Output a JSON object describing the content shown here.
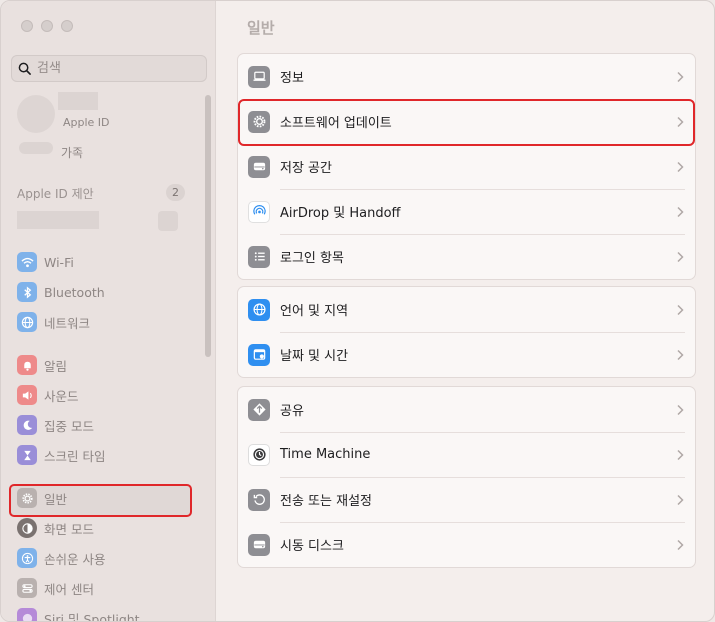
{
  "sidebar": {
    "search": {
      "placeholder": "검색"
    },
    "account": {
      "subtitle": "Apple ID",
      "family_label": "가족"
    },
    "suggestions": {
      "label": "Apple ID 제안",
      "count": "2"
    },
    "items": [
      {
        "label": "Wi-Fi",
        "icon": "wifi-icon",
        "color": "#7fb2ea"
      },
      {
        "label": "Bluetooth",
        "icon": "bluetooth-icon",
        "color": "#7fb2ea"
      },
      {
        "label": "네트워크",
        "icon": "globe-icon",
        "color": "#7fb2ea"
      },
      {
        "label": "알림",
        "icon": "bell-icon",
        "color": "#ee8a8a"
      },
      {
        "label": "사운드",
        "icon": "speaker-icon",
        "color": "#ee8a8a"
      },
      {
        "label": "집중 모드",
        "icon": "moon-icon",
        "color": "#9a8ed8"
      },
      {
        "label": "스크린 타임",
        "icon": "hourglass-icon",
        "color": "#9a8ed8"
      },
      {
        "label": "일반",
        "icon": "gear-icon",
        "color": "#b9b1af"
      },
      {
        "label": "화면 모드",
        "icon": "appearance-icon",
        "color": "#7a7270"
      },
      {
        "label": "손쉬운 사용",
        "icon": "accessibility-icon",
        "color": "#7fb2ea"
      },
      {
        "label": "제어 센터",
        "icon": "control-center-icon",
        "color": "#b9b1af"
      },
      {
        "label": "Siri 및 Spotlight",
        "icon": "siri-icon",
        "color": "#b58ad8"
      }
    ]
  },
  "main": {
    "title": "일반",
    "groups": [
      [
        {
          "label": "정보",
          "icon": "laptop-icon",
          "color": "#8e8e93"
        },
        {
          "label": "소프트웨어 업데이트",
          "icon": "gear-icon",
          "color": "#8e8e93"
        },
        {
          "label": "저장 공간",
          "icon": "drive-icon",
          "color": "#8e8e93"
        },
        {
          "label": "AirDrop 및 Handoff",
          "icon": "airdrop-icon",
          "color": "#2f8ff0"
        },
        {
          "label": "로그인 항목",
          "icon": "list-icon",
          "color": "#8e8e93"
        }
      ],
      [
        {
          "label": "언어 및 지역",
          "icon": "globe-icon",
          "color": "#2f8ff0"
        },
        {
          "label": "날짜 및 시간",
          "icon": "calendar-icon",
          "color": "#2f8ff0"
        }
      ],
      [
        {
          "label": "공유",
          "icon": "share-icon",
          "color": "#8e8e93"
        },
        {
          "label": "Time Machine",
          "icon": "time-machine-icon",
          "color": "#3a3a3c"
        },
        {
          "label": "전송 또는 재설정",
          "icon": "reset-icon",
          "color": "#8e8e93"
        },
        {
          "label": "시동 디스크",
          "icon": "disk-icon",
          "color": "#8e8e93"
        }
      ]
    ]
  }
}
